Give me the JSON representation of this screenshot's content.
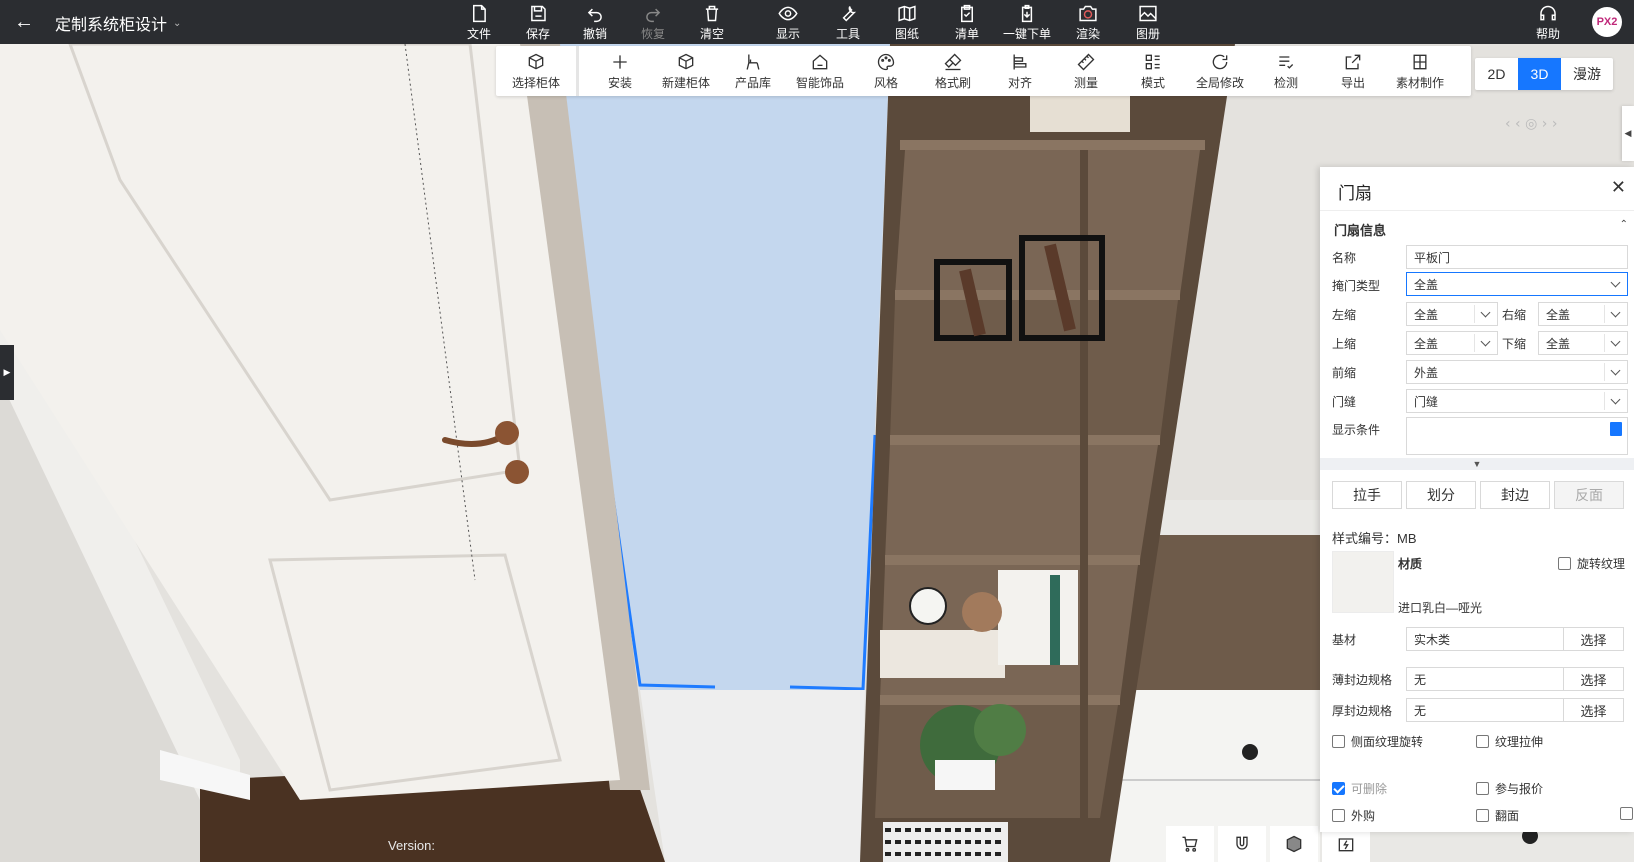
{
  "header": {
    "project_title": "定制系统柜设计",
    "tools": [
      {
        "label": "文件",
        "icon": "file-icon"
      },
      {
        "label": "保存",
        "icon": "save-icon"
      },
      {
        "label": "撤销",
        "icon": "undo-icon"
      },
      {
        "label": "恢复",
        "icon": "redo-icon"
      },
      {
        "label": "清空",
        "icon": "trash-icon"
      },
      {
        "label": "显示",
        "icon": "eye-icon"
      },
      {
        "label": "工具",
        "icon": "wrench-icon"
      },
      {
        "label": "图纸",
        "icon": "map-icon"
      },
      {
        "label": "清单",
        "icon": "clipboard-icon"
      },
      {
        "label": "一键下单",
        "icon": "order-icon"
      },
      {
        "label": "渲染",
        "icon": "camera-icon"
      },
      {
        "label": "图册",
        "icon": "image-icon"
      }
    ],
    "help_label": "帮助",
    "avatar_text": "PX2"
  },
  "subtoolbar": {
    "items": [
      {
        "label": "选择柜体",
        "icon": "cube-select-icon"
      },
      {
        "label": "安装",
        "icon": "plus-icon"
      },
      {
        "label": "新建柜体",
        "icon": "cube-icon"
      },
      {
        "label": "产品库",
        "icon": "chair-icon"
      },
      {
        "label": "智能饰品",
        "icon": "home-icon"
      },
      {
        "label": "风格",
        "icon": "palette-icon"
      },
      {
        "label": "格式刷",
        "icon": "brush-icon"
      },
      {
        "label": "对齐",
        "icon": "align-icon"
      },
      {
        "label": "测量",
        "icon": "ruler-icon"
      },
      {
        "label": "模式",
        "icon": "grid-icon"
      },
      {
        "label": "全局修改",
        "icon": "refresh-icon"
      },
      {
        "label": "检测",
        "icon": "check-list-icon"
      },
      {
        "label": "导出",
        "icon": "export-icon"
      },
      {
        "label": "素材制作",
        "icon": "material-icon"
      }
    ]
  },
  "view_modes": [
    "2D",
    "3D",
    "漫游"
  ],
  "active_view_mode": "3D",
  "version_label": "Version:",
  "panel": {
    "title": "门扇",
    "section_title": "门扇信息",
    "name_label": "名称",
    "name_value": "平板门",
    "door_type_label": "掩门类型",
    "door_type_value": "全盖",
    "left_shrink_label": "左缩",
    "left_shrink_value": "全盖",
    "right_shrink_label": "右缩",
    "right_shrink_value": "全盖",
    "top_shrink_label": "上缩",
    "top_shrink_value": "全盖",
    "bottom_shrink_label": "下缩",
    "bottom_shrink_value": "全盖",
    "front_shrink_label": "前缩",
    "front_shrink_value": "外盖",
    "gap_label": "门缝",
    "gap_value": "门缝",
    "condition_label": "显示条件",
    "condition_value": "",
    "buttons": [
      "拉手",
      "划分",
      "封边",
      "反面"
    ],
    "style_no": "样式编号：MB",
    "material_label": "材质",
    "rotate_texture_label": "旋转纹理",
    "material_name": "进口乳白—哑光",
    "base_label": "基材",
    "base_value": "实木类",
    "thin_edge_label": "薄封边规格",
    "thin_edge_value": "无",
    "thick_edge_label": "厚封边规格",
    "thick_edge_value": "无",
    "choose_label": "选择",
    "side_texture_label": "侧面纹理旋转",
    "texture_stretch_label": "纹理拉伸",
    "deletable_label": "可删除",
    "quote_label": "参与报价",
    "outsource_label": "外购",
    "flip_label": "翻面"
  },
  "colors": {
    "topbar": "#2b2d31",
    "accent": "#1677ff",
    "selection": "#c4d7ee",
    "shelf_wood": "#6e5b4a",
    "door_white": "#f3f1ed",
    "floor": "#4a3222"
  }
}
